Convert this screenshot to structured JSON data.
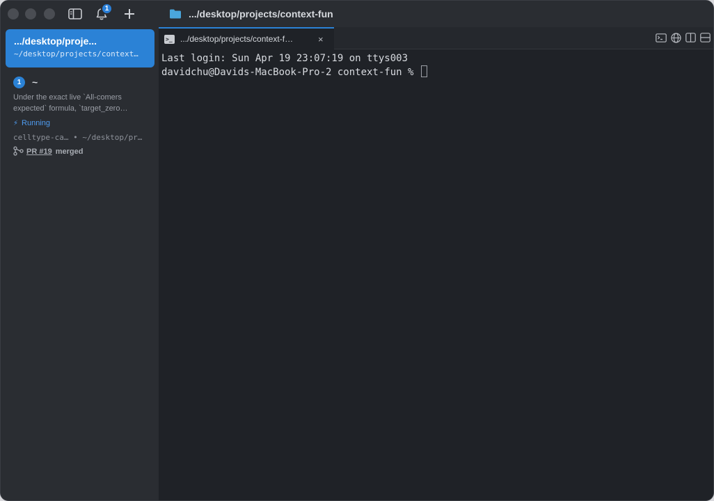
{
  "titlebar": {
    "notification_count": "1",
    "title": ".../desktop/projects/context-fun"
  },
  "sidebar": {
    "active_workspace": {
      "title": ".../desktop/proje...",
      "path": "~/desktop/projects/context…"
    },
    "workspace": {
      "number": "1",
      "name": "~",
      "description": "Under the exact live `All-comers expected` formula, `target_zero…",
      "status": "Running",
      "meta": "celltype-ca… • ~/desktop/pr…",
      "pr_label": "PR #19",
      "pr_state": "merged"
    }
  },
  "tabs": [
    {
      "label": ".../desktop/projects/context-f…",
      "close": "×"
    }
  ],
  "terminal": {
    "lines": [
      "Last login: Sun Apr 19 23:07:19 on ttys003",
      "davidchu@Davids-MacBook-Pro-2 context-fun % "
    ]
  },
  "colors": {
    "accent": "#2b82d6",
    "background": "#1f2227",
    "sidebar": "#2a2d32",
    "status_running": "#4f9cf0"
  },
  "icons": {
    "titlebar": [
      "sidebar-toggle-icon",
      "bell-icon",
      "plus-icon",
      "folder-icon"
    ],
    "tabbar_right": [
      "terminal-icon",
      "globe-icon",
      "split-vertical-icon",
      "split-horizontal-icon"
    ]
  }
}
